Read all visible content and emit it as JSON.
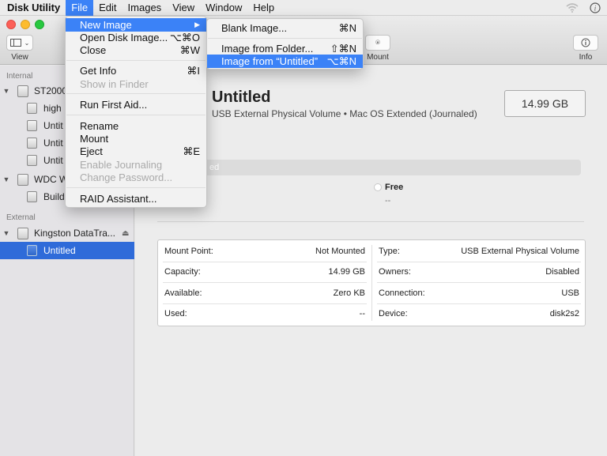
{
  "menubar": {
    "app": "Disk Utility",
    "items": [
      "File",
      "Edit",
      "Images",
      "View",
      "Window",
      "Help"
    ],
    "active": "File"
  },
  "toolbar": {
    "view_label": "View",
    "mount_label": "Mount",
    "info_label": "Info"
  },
  "sidebar": {
    "internal_header": "Internal",
    "external_header": "External",
    "rows": [
      {
        "label": "ST2000",
        "kind": "disk"
      },
      {
        "label": "high",
        "kind": "volume"
      },
      {
        "label": "Untit",
        "kind": "volume"
      },
      {
        "label": "Untit",
        "kind": "volume"
      },
      {
        "label": "Untit",
        "kind": "volume"
      },
      {
        "label": "WDC W",
        "kind": "disk"
      },
      {
        "label": "Build",
        "kind": "volume"
      },
      {
        "label": "Kingston DataTra...",
        "kind": "disk"
      },
      {
        "label": "Untitled",
        "kind": "volume",
        "selected": true
      }
    ]
  },
  "volume": {
    "title": "Untitled",
    "subtitle": "USB External Physical Volume • Mac OS Extended (Journaled)",
    "size": "14.99 GB",
    "usage_label": "ed",
    "free_label": "Free",
    "free_value": "--"
  },
  "info": {
    "left": [
      {
        "key": "Mount Point:",
        "value": "Not Mounted"
      },
      {
        "key": "Capacity:",
        "value": "14.99 GB"
      },
      {
        "key": "Available:",
        "value": "Zero KB"
      },
      {
        "key": "Used:",
        "value": "--"
      }
    ],
    "right": [
      {
        "key": "Type:",
        "value": "USB External Physical Volume"
      },
      {
        "key": "Owners:",
        "value": "Disabled"
      },
      {
        "key": "Connection:",
        "value": "USB"
      },
      {
        "key": "Device:",
        "value": "disk2s2"
      }
    ]
  },
  "file_menu": [
    {
      "label": "New Image",
      "shortcut": "▶",
      "highlighted": true
    },
    {
      "label": "Open Disk Image...",
      "shortcut": "⌥⌘O"
    },
    {
      "label": "Close",
      "shortcut": "⌘W"
    },
    {
      "label": "Get Info",
      "shortcut": "⌘I"
    },
    {
      "label": "Show in Finder",
      "shortcut": "",
      "disabled": true
    },
    {
      "label": "Run First Aid...",
      "shortcut": ""
    },
    {
      "label": "Rename",
      "shortcut": ""
    },
    {
      "label": "Mount",
      "shortcut": ""
    },
    {
      "label": "Eject",
      "shortcut": "⌘E"
    },
    {
      "label": "Enable Journaling",
      "shortcut": "",
      "disabled": true
    },
    {
      "label": "Change Password...",
      "shortcut": "",
      "disabled": true
    },
    {
      "label": "RAID Assistant...",
      "shortcut": ""
    }
  ],
  "new_image_submenu": [
    {
      "label": "Blank Image...",
      "shortcut": "⌘N"
    },
    {
      "label": "Image from Folder...",
      "shortcut": "⇧⌘N"
    },
    {
      "label": "Image from “Untitled”",
      "shortcut": "⌥⌘N",
      "highlighted": true
    }
  ],
  "colors": {
    "selection": "#3b82f7",
    "sidebar_selected": "#2f6bd9"
  }
}
